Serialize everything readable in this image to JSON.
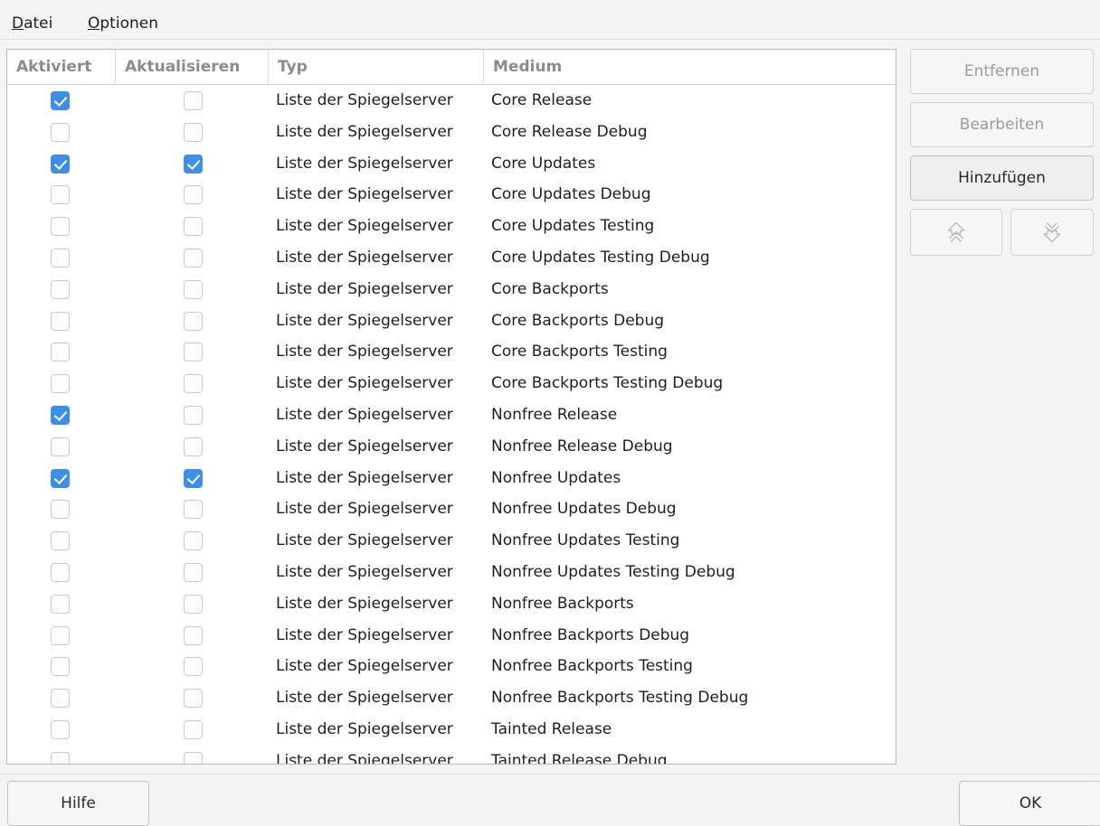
{
  "menubar": {
    "items": [
      {
        "mnemonic": "D",
        "rest": "atei"
      },
      {
        "mnemonic": "O",
        "rest": "ptionen"
      }
    ]
  },
  "table": {
    "headers": [
      "Aktiviert",
      "Aktualisieren",
      "Typ",
      "Medium"
    ],
    "rows": [
      {
        "aktiviert": true,
        "aktualisieren": false,
        "typ": "Liste der Spiegelserver",
        "medium": "Core Release"
      },
      {
        "aktiviert": false,
        "aktualisieren": false,
        "typ": "Liste der Spiegelserver",
        "medium": "Core Release Debug"
      },
      {
        "aktiviert": true,
        "aktualisieren": true,
        "typ": "Liste der Spiegelserver",
        "medium": "Core Updates"
      },
      {
        "aktiviert": false,
        "aktualisieren": false,
        "typ": "Liste der Spiegelserver",
        "medium": "Core Updates Debug"
      },
      {
        "aktiviert": false,
        "aktualisieren": false,
        "typ": "Liste der Spiegelserver",
        "medium": "Core Updates Testing"
      },
      {
        "aktiviert": false,
        "aktualisieren": false,
        "typ": "Liste der Spiegelserver",
        "medium": "Core Updates Testing Debug"
      },
      {
        "aktiviert": false,
        "aktualisieren": false,
        "typ": "Liste der Spiegelserver",
        "medium": "Core Backports"
      },
      {
        "aktiviert": false,
        "aktualisieren": false,
        "typ": "Liste der Spiegelserver",
        "medium": "Core Backports Debug"
      },
      {
        "aktiviert": false,
        "aktualisieren": false,
        "typ": "Liste der Spiegelserver",
        "medium": "Core Backports Testing"
      },
      {
        "aktiviert": false,
        "aktualisieren": false,
        "typ": "Liste der Spiegelserver",
        "medium": "Core Backports Testing Debug"
      },
      {
        "aktiviert": true,
        "aktualisieren": false,
        "typ": "Liste der Spiegelserver",
        "medium": "Nonfree Release"
      },
      {
        "aktiviert": false,
        "aktualisieren": false,
        "typ": "Liste der Spiegelserver",
        "medium": "Nonfree Release Debug"
      },
      {
        "aktiviert": true,
        "aktualisieren": true,
        "typ": "Liste der Spiegelserver",
        "medium": "Nonfree Updates"
      },
      {
        "aktiviert": false,
        "aktualisieren": false,
        "typ": "Liste der Spiegelserver",
        "medium": "Nonfree Updates Debug"
      },
      {
        "aktiviert": false,
        "aktualisieren": false,
        "typ": "Liste der Spiegelserver",
        "medium": "Nonfree Updates Testing"
      },
      {
        "aktiviert": false,
        "aktualisieren": false,
        "typ": "Liste der Spiegelserver",
        "medium": "Nonfree Updates Testing Debug"
      },
      {
        "aktiviert": false,
        "aktualisieren": false,
        "typ": "Liste der Spiegelserver",
        "medium": "Nonfree Backports"
      },
      {
        "aktiviert": false,
        "aktualisieren": false,
        "typ": "Liste der Spiegelserver",
        "medium": "Nonfree Backports Debug"
      },
      {
        "aktiviert": false,
        "aktualisieren": false,
        "typ": "Liste der Spiegelserver",
        "medium": "Nonfree Backports Testing"
      },
      {
        "aktiviert": false,
        "aktualisieren": false,
        "typ": "Liste der Spiegelserver",
        "medium": "Nonfree Backports Testing Debug"
      },
      {
        "aktiviert": false,
        "aktualisieren": false,
        "typ": "Liste der Spiegelserver",
        "medium": "Tainted Release"
      },
      {
        "aktiviert": false,
        "aktualisieren": false,
        "typ": "Liste der Spiegelserver",
        "medium": "Tainted Release Debug"
      }
    ]
  },
  "side_buttons": {
    "remove": "Entfernen",
    "edit": "Bearbeiten",
    "add": "Hinzufügen",
    "up_icon": "arrow-up-icon",
    "down_icon": "arrow-down-icon"
  },
  "footer": {
    "help": "Hilfe",
    "ok": "OK"
  },
  "colors": {
    "accent": "#3d8ee6",
    "disabled_text": "#9b9b9b"
  }
}
